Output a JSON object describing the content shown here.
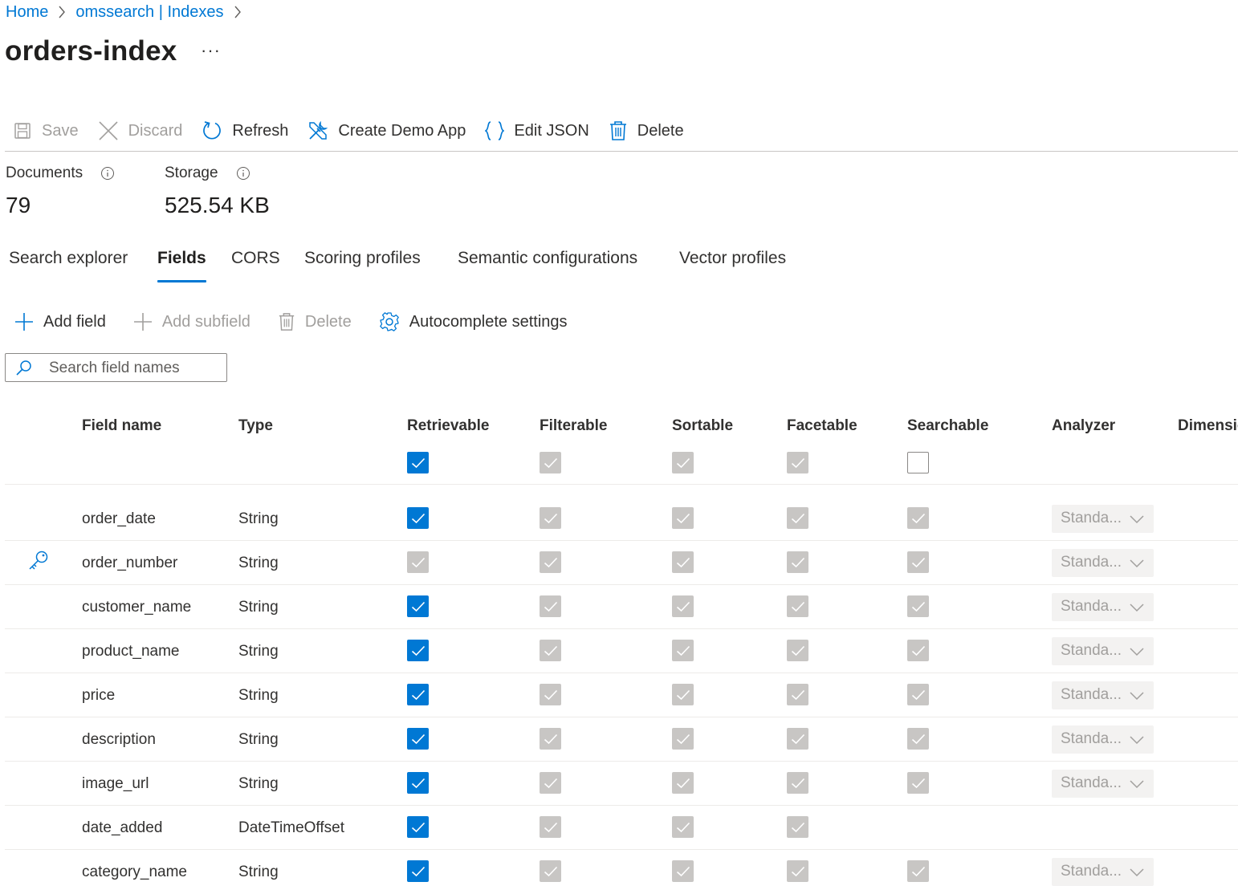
{
  "breadcrumb": [
    {
      "label": "Home"
    },
    {
      "label": "omssearch | Indexes"
    }
  ],
  "page_title": "orders-index",
  "title_more": "···",
  "commands": {
    "save": "Save",
    "discard": "Discard",
    "refresh": "Refresh",
    "create_demo_app": "Create Demo App",
    "edit_json": "Edit JSON",
    "delete": "Delete"
  },
  "stats": {
    "documents_label": "Documents",
    "documents_value": "79",
    "storage_label": "Storage",
    "storage_value": "525.54 KB"
  },
  "tabs": [
    {
      "label": "Search explorer",
      "active": false
    },
    {
      "label": "Fields",
      "active": true
    },
    {
      "label": "CORS",
      "active": false
    },
    {
      "label": "Scoring profiles",
      "active": false
    },
    {
      "label": "Semantic configurations",
      "active": false
    },
    {
      "label": "Vector profiles",
      "active": false
    }
  ],
  "field_toolbar": {
    "add_field": "Add field",
    "add_subfield": "Add subfield",
    "delete": "Delete",
    "autocomplete": "Autocomplete settings"
  },
  "search": {
    "placeholder": "Search field names"
  },
  "table": {
    "columns": {
      "field_name": "Field name",
      "type": "Type",
      "retrievable": "Retrievable",
      "filterable": "Filterable",
      "sortable": "Sortable",
      "facetable": "Facetable",
      "searchable": "Searchable",
      "analyzer": "Analyzer",
      "dimensions": "Dimensio"
    },
    "header_checks": {
      "retrievable": "checked",
      "filterable": "disabled",
      "sortable": "disabled",
      "facetable": "disabled",
      "searchable": "empty"
    },
    "rows": [
      {
        "name": "order_date",
        "type": "String",
        "key": false,
        "retrievable": "checked",
        "filterable": "disabled",
        "sortable": "disabled",
        "facetable": "disabled",
        "searchable": "disabled",
        "analyzer": "Standa..."
      },
      {
        "name": "order_number",
        "type": "String",
        "key": true,
        "retrievable": "disabled",
        "filterable": "disabled",
        "sortable": "disabled",
        "facetable": "disabled",
        "searchable": "disabled",
        "analyzer": "Standa..."
      },
      {
        "name": "customer_name",
        "type": "String",
        "key": false,
        "retrievable": "checked",
        "filterable": "disabled",
        "sortable": "disabled",
        "facetable": "disabled",
        "searchable": "disabled",
        "analyzer": "Standa..."
      },
      {
        "name": "product_name",
        "type": "String",
        "key": false,
        "retrievable": "checked",
        "filterable": "disabled",
        "sortable": "disabled",
        "facetable": "disabled",
        "searchable": "disabled",
        "analyzer": "Standa..."
      },
      {
        "name": "price",
        "type": "String",
        "key": false,
        "retrievable": "checked",
        "filterable": "disabled",
        "sortable": "disabled",
        "facetable": "disabled",
        "searchable": "disabled",
        "analyzer": "Standa..."
      },
      {
        "name": "description",
        "type": "String",
        "key": false,
        "retrievable": "checked",
        "filterable": "disabled",
        "sortable": "disabled",
        "facetable": "disabled",
        "searchable": "disabled",
        "analyzer": "Standa..."
      },
      {
        "name": "image_url",
        "type": "String",
        "key": false,
        "retrievable": "checked",
        "filterable": "disabled",
        "sortable": "disabled",
        "facetable": "disabled",
        "searchable": "disabled",
        "analyzer": "Standa..."
      },
      {
        "name": "date_added",
        "type": "DateTimeOffset",
        "key": false,
        "retrievable": "checked",
        "filterable": "disabled",
        "sortable": "disabled",
        "facetable": "disabled",
        "searchable": "none",
        "analyzer": ""
      },
      {
        "name": "category_name",
        "type": "String",
        "key": false,
        "retrievable": "checked",
        "filterable": "disabled",
        "sortable": "disabled",
        "facetable": "disabled",
        "searchable": "disabled",
        "analyzer": "Standa..."
      }
    ]
  },
  "colors": {
    "accent": "#0078d4",
    "disabled_check": "#c8c6c4",
    "text": "#323130",
    "muted": "#a19f9d"
  }
}
